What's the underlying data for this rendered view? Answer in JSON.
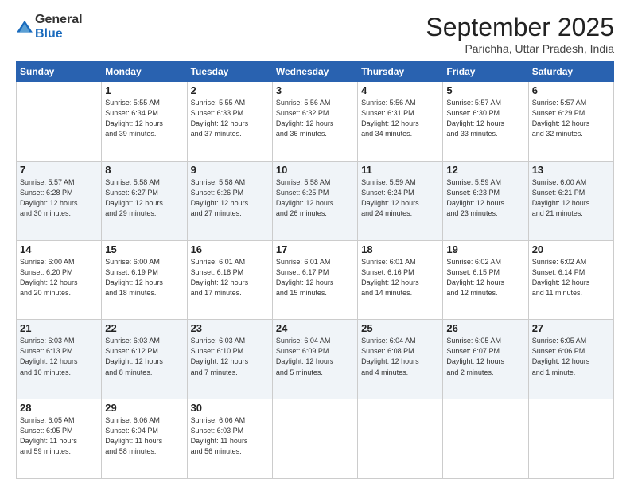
{
  "logo": {
    "general": "General",
    "blue": "Blue"
  },
  "header": {
    "month": "September 2025",
    "location": "Parichha, Uttar Pradesh, India"
  },
  "days_of_week": [
    "Sunday",
    "Monday",
    "Tuesday",
    "Wednesday",
    "Thursday",
    "Friday",
    "Saturday"
  ],
  "weeks": [
    [
      {
        "day": "",
        "info": ""
      },
      {
        "day": "1",
        "info": "Sunrise: 5:55 AM\nSunset: 6:34 PM\nDaylight: 12 hours\nand 39 minutes."
      },
      {
        "day": "2",
        "info": "Sunrise: 5:55 AM\nSunset: 6:33 PM\nDaylight: 12 hours\nand 37 minutes."
      },
      {
        "day": "3",
        "info": "Sunrise: 5:56 AM\nSunset: 6:32 PM\nDaylight: 12 hours\nand 36 minutes."
      },
      {
        "day": "4",
        "info": "Sunrise: 5:56 AM\nSunset: 6:31 PM\nDaylight: 12 hours\nand 34 minutes."
      },
      {
        "day": "5",
        "info": "Sunrise: 5:57 AM\nSunset: 6:30 PM\nDaylight: 12 hours\nand 33 minutes."
      },
      {
        "day": "6",
        "info": "Sunrise: 5:57 AM\nSunset: 6:29 PM\nDaylight: 12 hours\nand 32 minutes."
      }
    ],
    [
      {
        "day": "7",
        "info": "Sunrise: 5:57 AM\nSunset: 6:28 PM\nDaylight: 12 hours\nand 30 minutes."
      },
      {
        "day": "8",
        "info": "Sunrise: 5:58 AM\nSunset: 6:27 PM\nDaylight: 12 hours\nand 29 minutes."
      },
      {
        "day": "9",
        "info": "Sunrise: 5:58 AM\nSunset: 6:26 PM\nDaylight: 12 hours\nand 27 minutes."
      },
      {
        "day": "10",
        "info": "Sunrise: 5:58 AM\nSunset: 6:25 PM\nDaylight: 12 hours\nand 26 minutes."
      },
      {
        "day": "11",
        "info": "Sunrise: 5:59 AM\nSunset: 6:24 PM\nDaylight: 12 hours\nand 24 minutes."
      },
      {
        "day": "12",
        "info": "Sunrise: 5:59 AM\nSunset: 6:23 PM\nDaylight: 12 hours\nand 23 minutes."
      },
      {
        "day": "13",
        "info": "Sunrise: 6:00 AM\nSunset: 6:21 PM\nDaylight: 12 hours\nand 21 minutes."
      }
    ],
    [
      {
        "day": "14",
        "info": "Sunrise: 6:00 AM\nSunset: 6:20 PM\nDaylight: 12 hours\nand 20 minutes."
      },
      {
        "day": "15",
        "info": "Sunrise: 6:00 AM\nSunset: 6:19 PM\nDaylight: 12 hours\nand 18 minutes."
      },
      {
        "day": "16",
        "info": "Sunrise: 6:01 AM\nSunset: 6:18 PM\nDaylight: 12 hours\nand 17 minutes."
      },
      {
        "day": "17",
        "info": "Sunrise: 6:01 AM\nSunset: 6:17 PM\nDaylight: 12 hours\nand 15 minutes."
      },
      {
        "day": "18",
        "info": "Sunrise: 6:01 AM\nSunset: 6:16 PM\nDaylight: 12 hours\nand 14 minutes."
      },
      {
        "day": "19",
        "info": "Sunrise: 6:02 AM\nSunset: 6:15 PM\nDaylight: 12 hours\nand 12 minutes."
      },
      {
        "day": "20",
        "info": "Sunrise: 6:02 AM\nSunset: 6:14 PM\nDaylight: 12 hours\nand 11 minutes."
      }
    ],
    [
      {
        "day": "21",
        "info": "Sunrise: 6:03 AM\nSunset: 6:13 PM\nDaylight: 12 hours\nand 10 minutes."
      },
      {
        "day": "22",
        "info": "Sunrise: 6:03 AM\nSunset: 6:12 PM\nDaylight: 12 hours\nand 8 minutes."
      },
      {
        "day": "23",
        "info": "Sunrise: 6:03 AM\nSunset: 6:10 PM\nDaylight: 12 hours\nand 7 minutes."
      },
      {
        "day": "24",
        "info": "Sunrise: 6:04 AM\nSunset: 6:09 PM\nDaylight: 12 hours\nand 5 minutes."
      },
      {
        "day": "25",
        "info": "Sunrise: 6:04 AM\nSunset: 6:08 PM\nDaylight: 12 hours\nand 4 minutes."
      },
      {
        "day": "26",
        "info": "Sunrise: 6:05 AM\nSunset: 6:07 PM\nDaylight: 12 hours\nand 2 minutes."
      },
      {
        "day": "27",
        "info": "Sunrise: 6:05 AM\nSunset: 6:06 PM\nDaylight: 12 hours\nand 1 minute."
      }
    ],
    [
      {
        "day": "28",
        "info": "Sunrise: 6:05 AM\nSunset: 6:05 PM\nDaylight: 11 hours\nand 59 minutes."
      },
      {
        "day": "29",
        "info": "Sunrise: 6:06 AM\nSunset: 6:04 PM\nDaylight: 11 hours\nand 58 minutes."
      },
      {
        "day": "30",
        "info": "Sunrise: 6:06 AM\nSunset: 6:03 PM\nDaylight: 11 hours\nand 56 minutes."
      },
      {
        "day": "",
        "info": ""
      },
      {
        "day": "",
        "info": ""
      },
      {
        "day": "",
        "info": ""
      },
      {
        "day": "",
        "info": ""
      }
    ]
  ]
}
